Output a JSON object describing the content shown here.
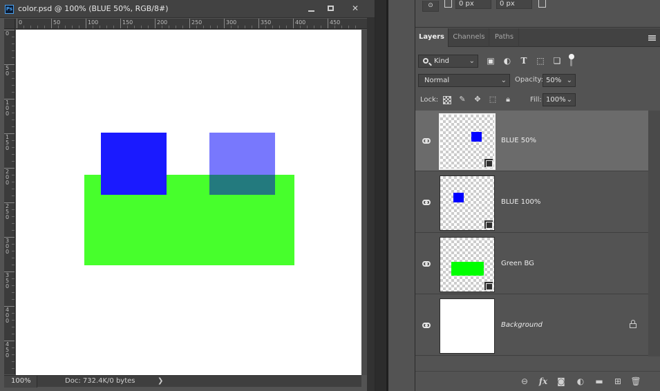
{
  "document": {
    "app_logo": "Ps",
    "title": "color.psd @ 100% (BLUE 50%, RGB/8#)",
    "zoom": "100%",
    "doc_info": "Doc: 732.4K/0 bytes",
    "status_arrow": "❯",
    "ruler_labels_h": [
      "0",
      "50",
      "100",
      "150",
      "200",
      "250",
      "300",
      "350",
      "400",
      "450"
    ],
    "ruler_labels_v": [
      "0",
      "50",
      "100",
      "150",
      "200",
      "250",
      "300",
      "350",
      "400",
      "450"
    ],
    "shapes": [
      {
        "name": "green-rectangle",
        "color": "#47ff2c"
      },
      {
        "name": "blue-100-square",
        "color": "#1a1aff"
      },
      {
        "name": "blue-50-square-top",
        "color": "#7878fd"
      },
      {
        "name": "blue-50-square-overlap",
        "color": "#237a7e"
      }
    ]
  },
  "properties": {
    "x_value": "0 px",
    "y_value": "0 px"
  },
  "layers_panel": {
    "tabs": [
      "Layers",
      "Channels",
      "Paths"
    ],
    "kind_filter": "Kind",
    "blend_mode": "Normal",
    "opacity_label": "Opacity:",
    "opacity_value": "50%",
    "lock_label": "Lock:",
    "fill_label": "Fill:",
    "fill_value": "100%",
    "layers": [
      {
        "name": "BLUE 50%",
        "selected": true,
        "visible": true,
        "locked": false,
        "thumb_color": "#0000ff"
      },
      {
        "name": "BLUE 100%",
        "selected": false,
        "visible": true,
        "locked": false,
        "thumb_color": "#0000ff"
      },
      {
        "name": "Green BG",
        "selected": false,
        "visible": true,
        "locked": false,
        "thumb_color": "#00ff00"
      },
      {
        "name": "Background",
        "selected": false,
        "visible": true,
        "locked": true,
        "thumb_color": "#ffffff"
      }
    ],
    "footer_icons": [
      "link-icon",
      "fx-icon",
      "mask-icon",
      "adjustment-icon",
      "folder-icon",
      "new-layer-icon",
      "trash-icon"
    ]
  }
}
